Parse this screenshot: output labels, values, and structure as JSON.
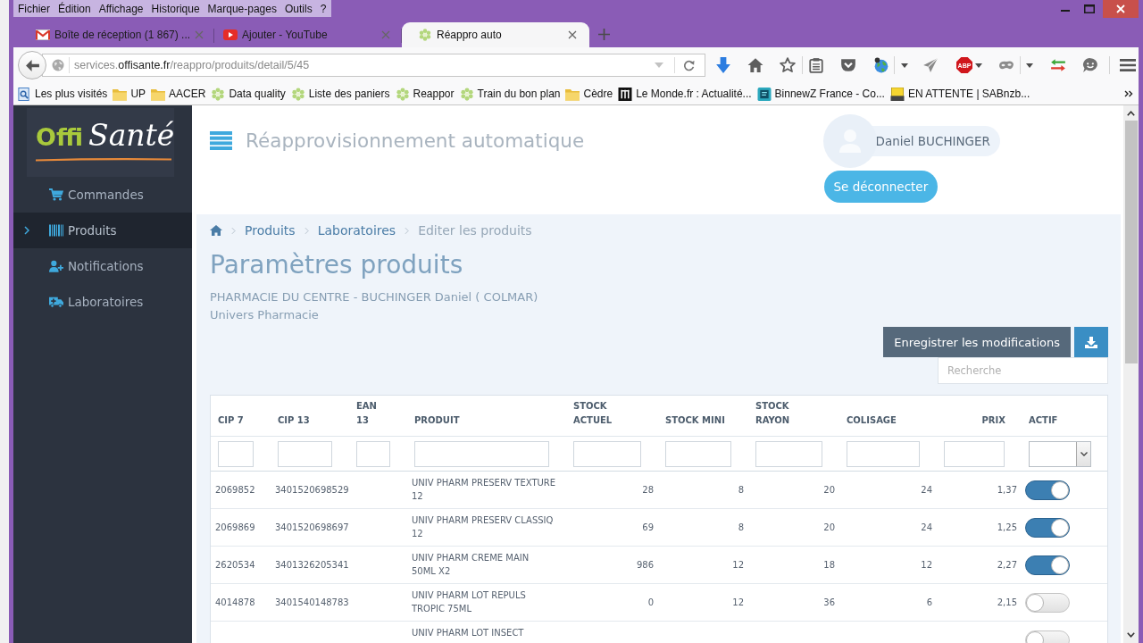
{
  "menu_bar": {
    "items": [
      "Fichier",
      "Édition",
      "Affichage",
      "Historique",
      "Marque-pages",
      "Outils",
      "?"
    ]
  },
  "tabs": [
    {
      "title": "Boîte de réception (1 867) ...",
      "selected": false
    },
    {
      "title": "Ajouter - YouTube",
      "selected": false
    },
    {
      "title": "Réappro auto",
      "selected": true
    }
  ],
  "address_bar": {
    "url_prefix": "services.",
    "url_domain": "offisante.fr",
    "url_path": "/reappro/produits/detail/5/45"
  },
  "toolbar": {
    "adblock_label": "ABP"
  },
  "bookmarks": [
    {
      "label": "Les plus visités",
      "kind": "link"
    },
    {
      "label": "UP",
      "kind": "folder"
    },
    {
      "label": "AACER",
      "kind": "folder"
    },
    {
      "label": "Data quality",
      "kind": "link"
    },
    {
      "label": "Liste des paniers",
      "kind": "link"
    },
    {
      "label": "Reappor",
      "kind": "link"
    },
    {
      "label": "Train du bon plan",
      "kind": "link"
    },
    {
      "label": "Cèdre",
      "kind": "folder"
    },
    {
      "label": "Le Monde.fr : Actualité...",
      "kind": "link"
    },
    {
      "label": "BinnewZ France - Co...",
      "kind": "link"
    },
    {
      "label": "EN ATTENTE | SABnzb...",
      "kind": "link"
    }
  ],
  "sidebar": {
    "logo": {
      "first": "Offi",
      "second": "Santé"
    },
    "items": [
      {
        "label": "Commandes",
        "selected": false
      },
      {
        "label": "Produits",
        "selected": true
      },
      {
        "label": "Notifications",
        "selected": false
      },
      {
        "label": "Laboratoires",
        "selected": false
      }
    ]
  },
  "header": {
    "title": "Réapprovisionnement automatique",
    "user_name": "Daniel BUCHINGER",
    "logout": "Se déconnecter"
  },
  "breadcrumb": [
    {
      "label": "Produits",
      "current": false
    },
    {
      "label": "Laboratoires",
      "current": false
    },
    {
      "label": "Editer les produits",
      "current": true
    }
  ],
  "page": {
    "title": "Paramètres produits",
    "lines": [
      "PHARMACIE DU CENTRE - BUCHINGER Daniel ( COLMAR)",
      "Univers Pharmacie"
    ]
  },
  "actions": {
    "save": "Enregistrer les modifications",
    "search_placeholder": "Recherche"
  },
  "table": {
    "columns": [
      {
        "label": "CIP 7",
        "kind": "code"
      },
      {
        "label": "CIP 13",
        "kind": "code"
      },
      {
        "label": "EAN\n13",
        "kind": "code"
      },
      {
        "label": "PRODUIT",
        "kind": "text"
      },
      {
        "label": "STOCK\nACTUEL",
        "kind": "number"
      },
      {
        "label": "STOCK MINI",
        "kind": "number"
      },
      {
        "label": "STOCK\nRAYON",
        "kind": "number"
      },
      {
        "label": "COLISAGE",
        "kind": "number"
      },
      {
        "label": "PRIX",
        "kind": "price"
      },
      {
        "label": "ACTIF",
        "kind": "toggle"
      }
    ],
    "rows": [
      {
        "cip_7": "2069852",
        "cip_13": "3401520698529",
        "produit": "UNIV PHARM PRESERV TEXTURE\n12",
        "stock_actuel": "28",
        "stock_mini": "8",
        "stock_rayon": "20",
        "colisage": "24",
        "prix": "1,37",
        "actif": true
      },
      {
        "cip_7": "2069869",
        "cip_13": "3401520698697",
        "produit": "UNIV PHARM PRESERV CLASSIQ\n12",
        "stock_actuel": "69",
        "stock_mini": "8",
        "stock_rayon": "20",
        "colisage": "24",
        "prix": "1,25",
        "actif": true
      },
      {
        "cip_7": "2620534",
        "cip_13": "3401326205341",
        "produit": "UNIV PHARM CREME MAIN\n50ML X2",
        "stock_actuel": "986",
        "stock_mini": "12",
        "stock_rayon": "18",
        "colisage": "12",
        "prix": "2,27",
        "actif": true
      },
      {
        "cip_7": "4014878",
        "cip_13": "3401540148783",
        "produit": "UNIV PHARM LOT REPULS\nTROPIC 75ML",
        "stock_actuel": "0",
        "stock_mini": "12",
        "stock_rayon": "36",
        "colisage": "6",
        "prix": "2,15",
        "actif": false
      },
      {
        "produit": "UNIV PHARM LOT INSECT",
        "actif": false
      }
    ]
  }
}
